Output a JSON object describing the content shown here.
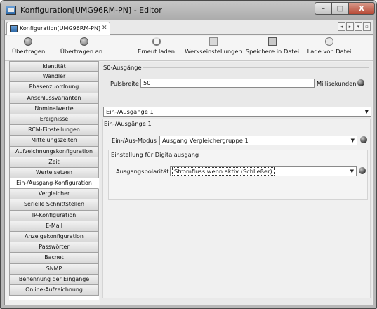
{
  "window": {
    "title": "Konfiguration[UMG96RM-PN] - Editor",
    "minimize": "–",
    "maximize": "□",
    "close": "X"
  },
  "tab": {
    "label": "Konfiguration[UMG96RM-PN]",
    "close": "✕"
  },
  "tab_nav": {
    "left": "◂",
    "right": "▸",
    "menu": "▾",
    "restore": "▫"
  },
  "toolbar": {
    "transfer": "Übertragen",
    "transfer_to": "Übertragen an ..",
    "reload": "Erneut laden",
    "factory": "Werkseinstellungen",
    "save_file": "Speichere in Datei",
    "load_file": "Lade von Datei"
  },
  "sidebar": {
    "items": [
      "Identität",
      "Wandler",
      "Phasenzuordnung",
      "Anschlussvarianten",
      "Nominalwerte",
      "Ereignisse",
      "RCM-Einstellungen",
      "Mittelungszeiten",
      "Aufzeichnungskonfiguration",
      "Zeit",
      "Werte setzen",
      "Ein-/Ausgang-Konfiguration",
      "Vergleicher",
      "Serielle Schnittstellen",
      "IP-Konfiguration",
      "E-Mail",
      "Anzeigekonfiguration",
      "Passwörter",
      "Bacnet",
      "SNMP",
      "Benennung der Eingänge",
      "Online-Aufzeichnung"
    ],
    "active_index": 11
  },
  "s0": {
    "header": "S0-Ausgänge",
    "pulse_label": "Pulsbreite",
    "pulse_value": "50",
    "unit": "Millisekunden"
  },
  "io_select": {
    "value": "Ein-/Ausgänge 1"
  },
  "io_group": {
    "header": "Ein-/Ausgänge 1",
    "mode_label": "Ein-/Aus-Modus",
    "mode_value": "Ausgang Vergleichergruppe 1",
    "digital_header": "Einstellung für Digitalausgang",
    "polarity_label": "Ausgangspolarität",
    "polarity_value": "Stromfluss wenn aktiv (Schließer)"
  },
  "colors": {
    "titlebar": "#b8b8b8",
    "sidebar_active": "#ffffff",
    "status_dot": "#3a3a3a"
  }
}
